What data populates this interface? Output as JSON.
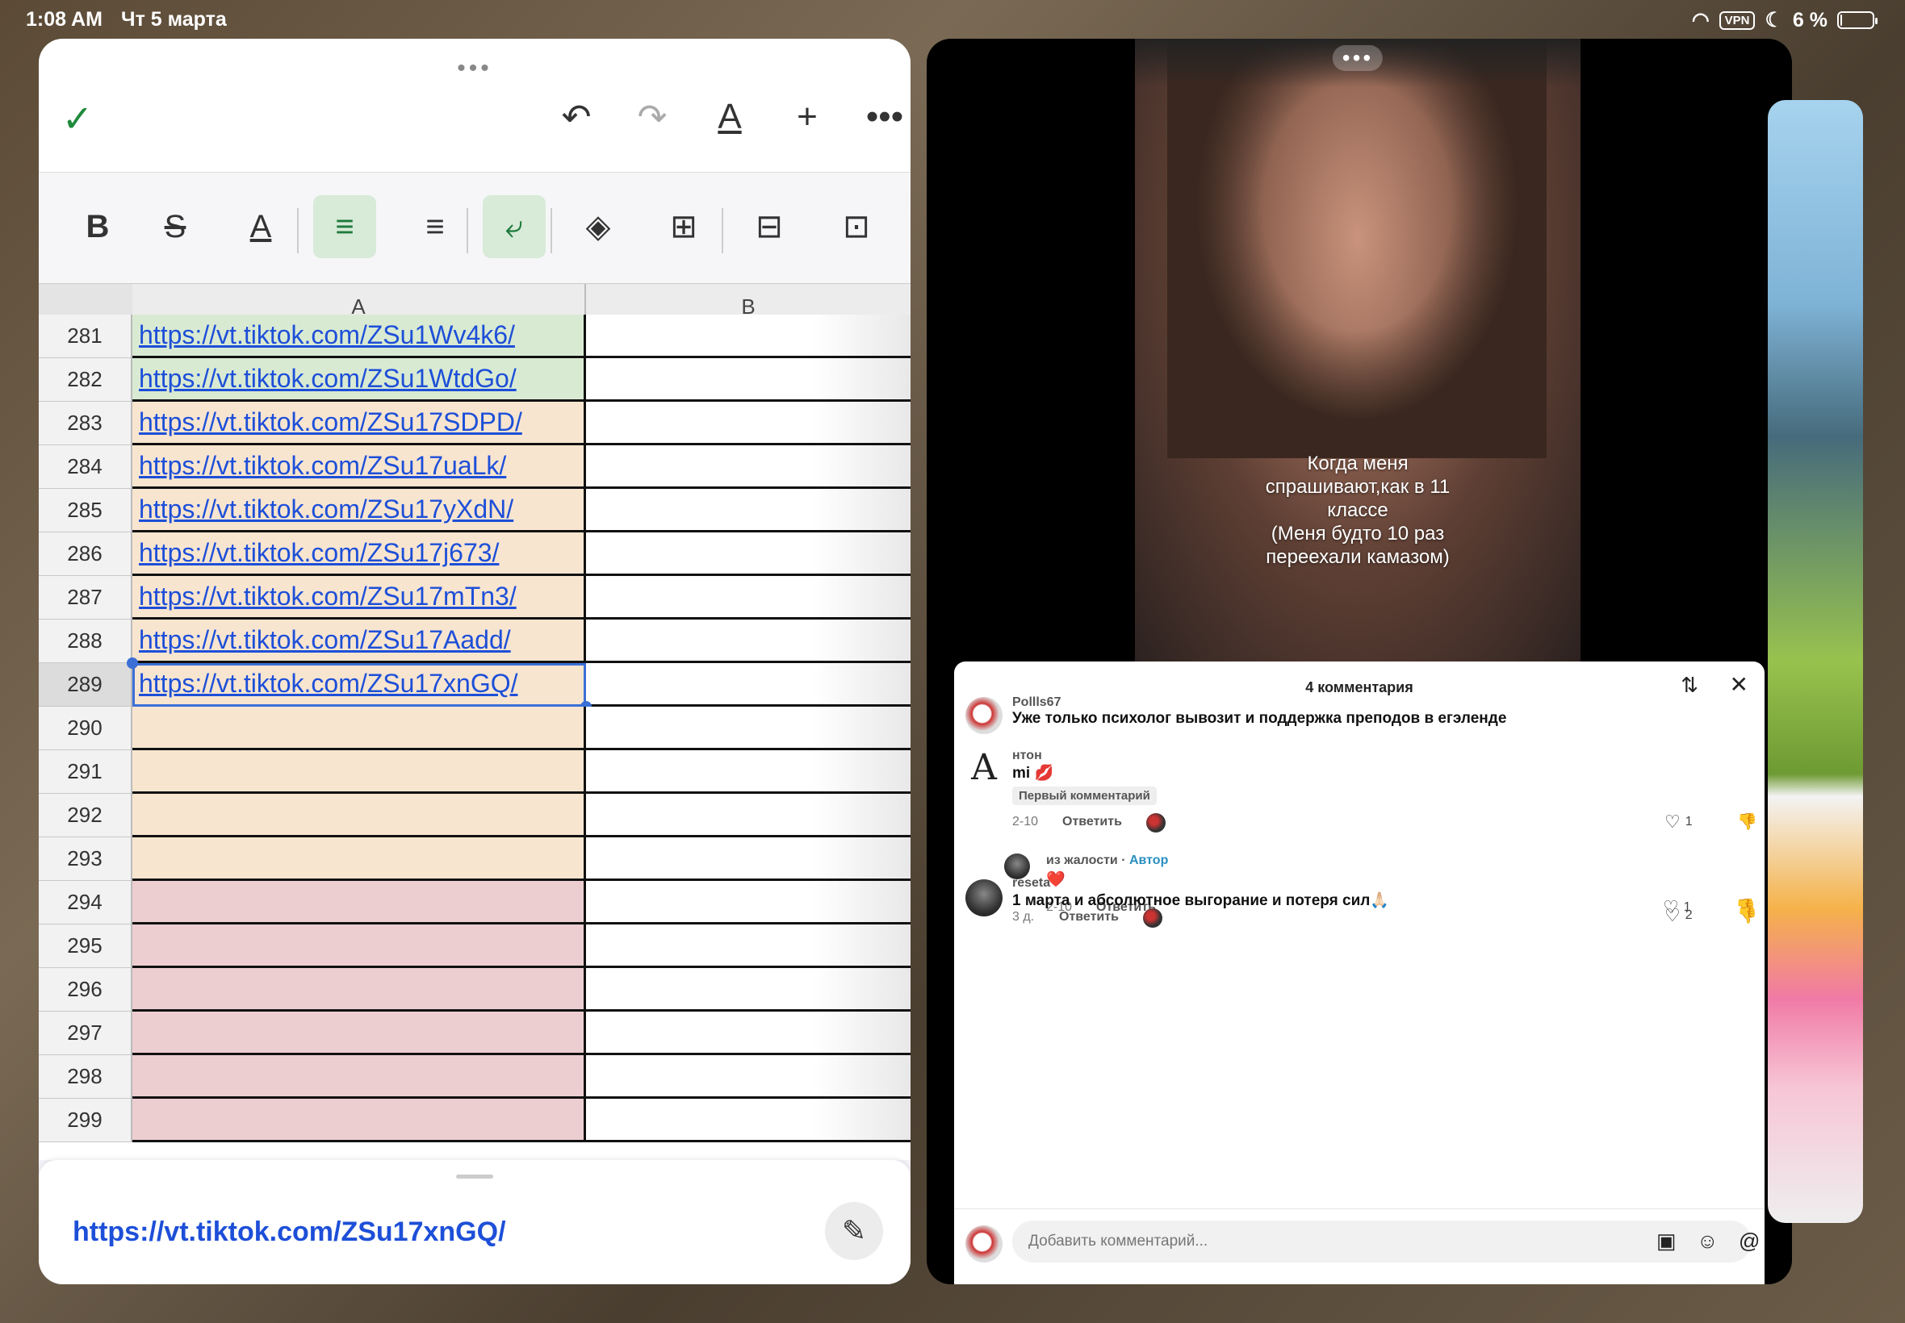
{
  "status": {
    "time": "1:08 AM",
    "date": "Чт 5 марта",
    "vpn": "VPN",
    "battery": "6 %",
    "battery_level": 0.06
  },
  "spreadsheet": {
    "col_a": "A",
    "col_b": "B",
    "rows": [
      {
        "num": "281",
        "value": "https://vt.tiktok.com/ZSu1Wv4k6/",
        "fill": "green"
      },
      {
        "num": "282",
        "value": "https://vt.tiktok.com/ZSu1WtdGo/",
        "fill": "green"
      },
      {
        "num": "283",
        "value": "https://vt.tiktok.com/ZSu17SDPD/",
        "fill": "peach"
      },
      {
        "num": "284",
        "value": "https://vt.tiktok.com/ZSu17uaLk/",
        "fill": "peach"
      },
      {
        "num": "285",
        "value": "https://vt.tiktok.com/ZSu17yXdN/",
        "fill": "peach"
      },
      {
        "num": "286",
        "value": "https://vt.tiktok.com/ZSu17j673/",
        "fill": "peach"
      },
      {
        "num": "287",
        "value": "https://vt.tiktok.com/ZSu17mTn3/",
        "fill": "peach"
      },
      {
        "num": "288",
        "value": "https://vt.tiktok.com/ZSu17Aadd/",
        "fill": "peach"
      },
      {
        "num": "289",
        "value": "https://vt.tiktok.com/ZSu17xnGQ/",
        "fill": "peach",
        "selected": true
      },
      {
        "num": "290",
        "value": "",
        "fill": "peach"
      },
      {
        "num": "291",
        "value": "",
        "fill": "peach"
      },
      {
        "num": "292",
        "value": "",
        "fill": "peach"
      },
      {
        "num": "293",
        "value": "",
        "fill": "peach"
      },
      {
        "num": "294",
        "value": "",
        "fill": "pink"
      },
      {
        "num": "295",
        "value": "",
        "fill": "pink"
      },
      {
        "num": "296",
        "value": "",
        "fill": "pink"
      },
      {
        "num": "297",
        "value": "",
        "fill": "pink"
      },
      {
        "num": "298",
        "value": "",
        "fill": "pink"
      },
      {
        "num": "299",
        "value": "",
        "fill": "pink"
      }
    ],
    "selected_cell_value": "https://vt.tiktok.com/ZSu17xnGQ/"
  },
  "video": {
    "caption_lines": [
      "Когда меня",
      "спрашивают,как в 11",
      "классе",
      "(Меня  будто 10 раз",
      "переехали камазом)"
    ]
  },
  "comments": {
    "title": "4 комментария",
    "input_placeholder": "Добавить комментарий...",
    "items": [
      {
        "user": "Pollls67",
        "text": "Уже только психолог вывозит и поддержка преподов в егэленде"
      },
      {
        "user": "нтон",
        "avatar_letter": "A",
        "text": "mi 💋",
        "badge": "Первый комментарий",
        "date": "2-10",
        "reply": "Ответить",
        "likes": "1"
      },
      {
        "user": "из жалости",
        "author_tag": "Автор",
        "text": "❤️",
        "date": "2-10",
        "reply": "Ответить",
        "likes": "1"
      },
      {
        "user": "reseta",
        "text": "1 марта и абсолютное выгорание и потеря сил🙏🏻",
        "date": "3 д.",
        "reply": "Ответить",
        "likes": "2"
      }
    ]
  }
}
